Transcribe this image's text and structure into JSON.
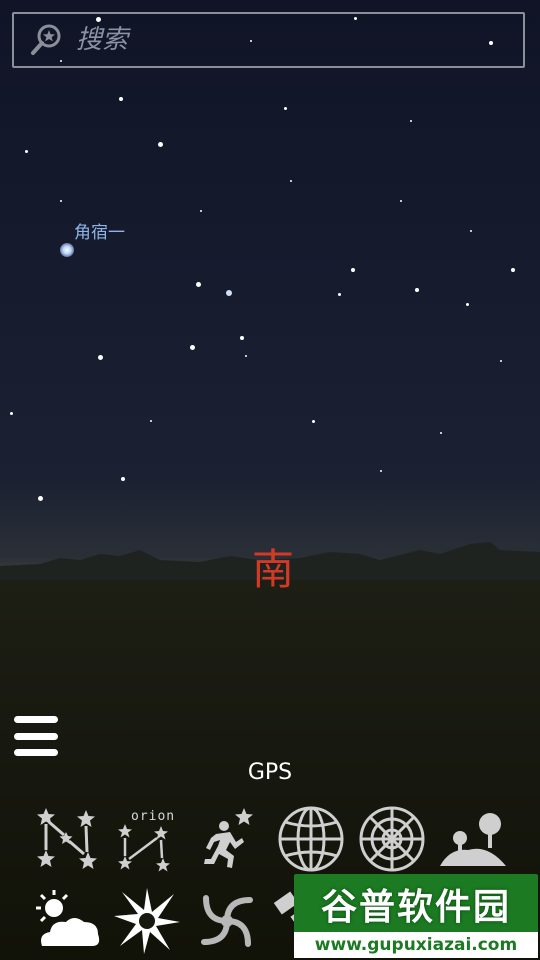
{
  "search": {
    "placeholder": "搜索"
  },
  "sky": {
    "star_label": "角宿一",
    "compass_direction": "南"
  },
  "gps_label": "GPS",
  "toolbar": {
    "row1": [
      {
        "icon": "constellation-lines-icon"
      },
      {
        "icon": "constellation-names-icon",
        "text": "orion"
      },
      {
        "icon": "runner-icon"
      },
      {
        "icon": "equatorial-grid-icon"
      },
      {
        "icon": "azimuthal-grid-icon"
      },
      {
        "icon": "landscape-icon"
      }
    ],
    "row2": [
      {
        "icon": "atmosphere-icon"
      },
      {
        "icon": "starburst-icon"
      },
      {
        "icon": "galaxy-icon"
      },
      {
        "icon": "satellite-icon"
      }
    ]
  },
  "watermark": {
    "title": "谷普软件园",
    "url": "www.gupuxiazai.com"
  },
  "colors": {
    "compass": "#d23a25",
    "label": "#8fb3e6",
    "watermark_green": "#1b7a22"
  }
}
